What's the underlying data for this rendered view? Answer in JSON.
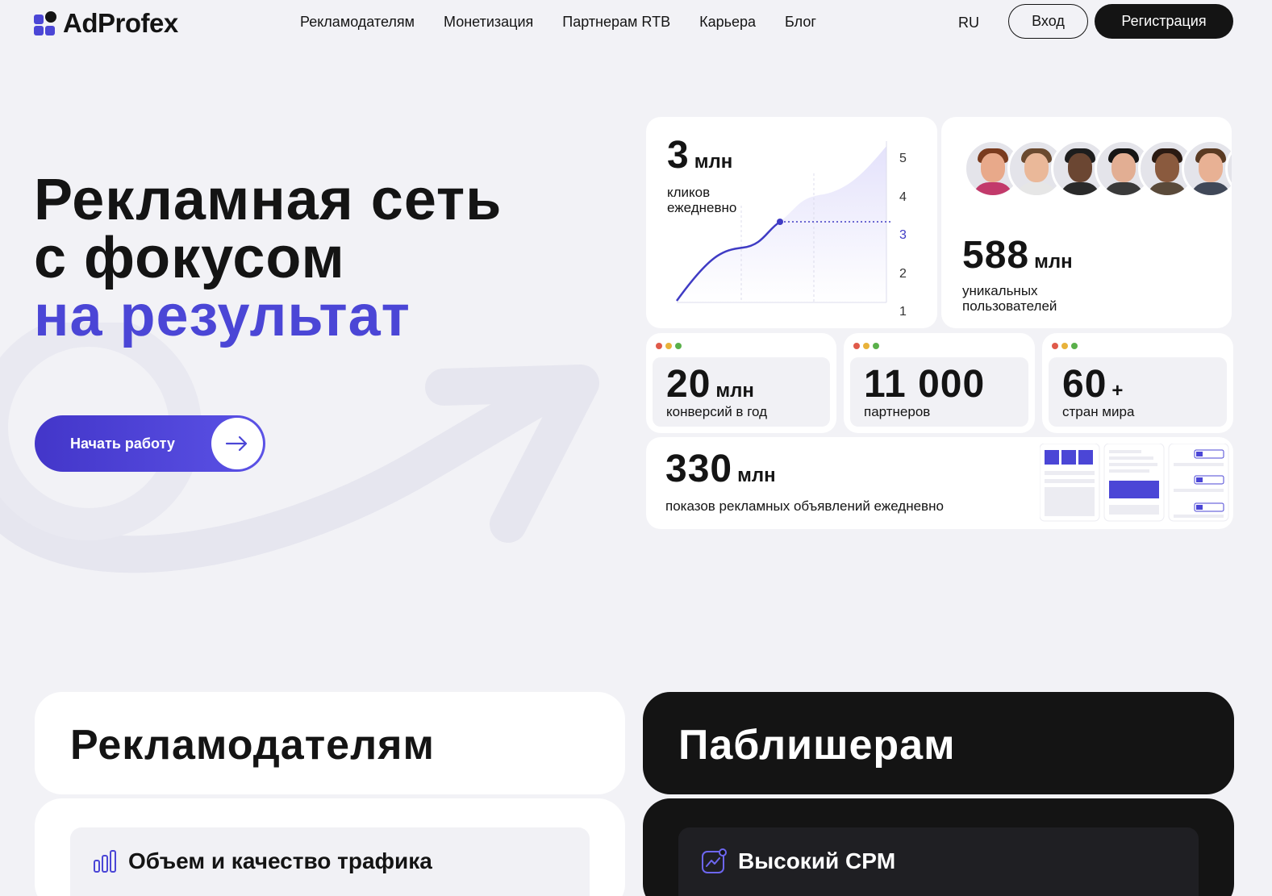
{
  "header": {
    "logo_text": "AdProfex",
    "nav": [
      "Рекламодателям",
      "Монетизация",
      "Партнерам RTB",
      "Карьера",
      "Блог"
    ],
    "lang": "RU",
    "login_label": "Вход",
    "register_label": "Регистрация"
  },
  "hero": {
    "line1": "Рекламная сеть",
    "line2": "с фокусом",
    "line3": "на результат",
    "cta_label": "Начать работу"
  },
  "stats": {
    "clicks": {
      "value": "3",
      "unit": "млн",
      "label1": "кликов",
      "label2": "ежедневно",
      "axis": [
        "5",
        "4",
        "3",
        "2",
        "1"
      ]
    },
    "users": {
      "value": "588",
      "unit": "млн",
      "label1": "уникальных",
      "label2": "пользователей"
    },
    "conversions": {
      "value": "20",
      "unit": "млн",
      "label": "конверсий в год"
    },
    "partners": {
      "value": "11 000",
      "unit": "",
      "label": "партнеров"
    },
    "countries": {
      "value": "60",
      "unit": "+",
      "label": "стран мира"
    },
    "impressions": {
      "value": "330",
      "unit": "млн",
      "label": "показов рекламных объявлений ежедневно"
    }
  },
  "panels": {
    "advertisers": {
      "title": "Рекламодателям",
      "feature": "Объем и качество трафика"
    },
    "publishers": {
      "title": "Паблишерам",
      "feature": "Высокий CPM"
    }
  },
  "colors": {
    "accent": "#4b46d6",
    "dark": "#141414",
    "background": "#f2f2f6"
  }
}
